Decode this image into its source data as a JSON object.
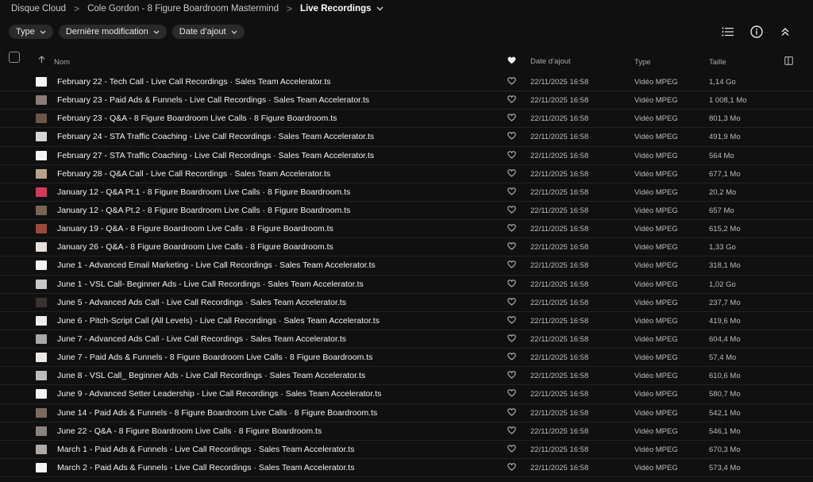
{
  "breadcrumb": {
    "items": [
      "Disque Cloud",
      "Cole Gordon - 8 Figure Boardroom Mastermind"
    ],
    "current": "Live Recordings",
    "separator": ">"
  },
  "filters": [
    {
      "label": "Type"
    },
    {
      "label": "Dernière modification"
    },
    {
      "label": "Date d’ajout"
    }
  ],
  "table": {
    "headers": {
      "name": "Nom",
      "date": "Date d’ajout",
      "type": "Type",
      "size": "Taille"
    },
    "rows": [
      {
        "name": "February 22 - Tech Call - Live Call Recordings · Sales Team Accelerator.ts",
        "date": "22/11/2025 16:58",
        "type": "Vidéo MPEG",
        "size": "1,14 Go",
        "thumb": "#f4f4f4"
      },
      {
        "name": "February 23 - Paid Ads & Funnels - Live Call Recordings · Sales Team Accelerator.ts",
        "date": "22/11/2025 16:58",
        "type": "Vidéo MPEG",
        "size": "1 008,1 Mo",
        "thumb": "#8a7a78"
      },
      {
        "name": "February 23 - Q&A - 8 Figure Boardroom Live Calls · 8 Figure Boardroom.ts",
        "date": "22/11/2025 16:58",
        "type": "Vidéo MPEG",
        "size": "801,3 Mo",
        "thumb": "#6b5648"
      },
      {
        "name": "February 24 - STA Traffic Coaching - Live Call Recordings · Sales Team Accelerator.ts",
        "date": "22/11/2025 16:58",
        "type": "Vidéo MPEG",
        "size": "491,9 Mo",
        "thumb": "#d6d6d6"
      },
      {
        "name": "February 27 - STA Traffic Coaching - Live Call Recordings · Sales Team Accelerator.ts",
        "date": "22/11/2025 16:58",
        "type": "Vidéo MPEG",
        "size": "564 Mo",
        "thumb": "#f4f4f4"
      },
      {
        "name": "February 28 - Q&A Call - Live Call Recordings · Sales Team Accelerator.ts",
        "date": "22/11/2025 16:58",
        "type": "Vidéo MPEG",
        "size": "677,1 Mo",
        "thumb": "#b9a28c"
      },
      {
        "name": "January 12 - Q&A Pt.1 - 8 Figure Boardroom Live Calls · 8 Figure Boardroom.ts",
        "date": "22/11/2025 16:58",
        "type": "Vidéo MPEG",
        "size": "20,2 Mo",
        "thumb": "#d23a5c"
      },
      {
        "name": "January 12 - Q&A Pt.2 - 8 Figure Boardroom Live Calls · 8 Figure Boardroom.ts",
        "date": "22/11/2025 16:58",
        "type": "Vidéo MPEG",
        "size": "657 Mo",
        "thumb": "#7a6552"
      },
      {
        "name": "January 19 - Q&A - 8 Figure Boardroom Live Calls · 8 Figure Boardroom.ts",
        "date": "22/11/2025 16:58",
        "type": "Vidéo MPEG",
        "size": "615,2 Mo",
        "thumb": "#9a4a3a"
      },
      {
        "name": "January 26 - Q&A - 8 Figure Boardroom Live Calls · 8 Figure Boardroom.ts",
        "date": "22/11/2025 16:58",
        "type": "Vidéo MPEG",
        "size": "1,33 Go",
        "thumb": "#e8e0d8"
      },
      {
        "name": "June 1 - Advanced Email Marketing - Live Call Recordings · Sales Team Accelerator.ts",
        "date": "22/11/2025 16:58",
        "type": "Vidéo MPEG",
        "size": "318,1 Mo",
        "thumb": "#f4f4f4"
      },
      {
        "name": "June 1 - VSL Call- Beginner Ads - Live Call Recordings · Sales Team Accelerator.ts",
        "date": "22/11/2025 16:58",
        "type": "Vidéo MPEG",
        "size": "1,02 Go",
        "thumb": "#c8c8c8"
      },
      {
        "name": "June 5 - Advanced Ads Call - Live Call Recordings · Sales Team Accelerator.ts",
        "date": "22/11/2025 16:58",
        "type": "Vidéo MPEG",
        "size": "237,7 Mo",
        "thumb": "#3a3230"
      },
      {
        "name": "June 6 - Pitch-Script Call (All Levels) - Live Call Recordings · Sales Team Accelerator.ts",
        "date": "22/11/2025 16:58",
        "type": "Vidéo MPEG",
        "size": "419,6 Mo",
        "thumb": "#ececec"
      },
      {
        "name": "June 7 - Advanced Ads Call - Live Call Recordings · Sales Team Accelerator.ts",
        "date": "22/11/2025 16:58",
        "type": "Vidéo MPEG",
        "size": "604,4 Mo",
        "thumb": "#a8a8a8"
      },
      {
        "name": "June 7 - Paid Ads & Funnels - 8 Figure Boardroom Live Calls · 8 Figure Boardroom.ts",
        "date": "22/11/2025 16:58",
        "type": "Vidéo MPEG",
        "size": "57,4 Mo",
        "thumb": "#ece8e4"
      },
      {
        "name": "June 8 - VSL Call_ Beginner Ads - Live Call Recordings · Sales Team Accelerator.ts",
        "date": "22/11/2025 16:58",
        "type": "Vidéo MPEG",
        "size": "610,6 Mo",
        "thumb": "#bdbdbd"
      },
      {
        "name": "June 9 - Advanced Setter Leadership - Live Call Recordings · Sales Team Accelerator.ts",
        "date": "22/11/2025 16:58",
        "type": "Vidéo MPEG",
        "size": "580,7 Mo",
        "thumb": "#f4f4f4"
      },
      {
        "name": "June 14 - Paid Ads & Funnels - 8 Figure Boardroom Live Calls · 8 Figure Boardroom.ts",
        "date": "22/11/2025 16:58",
        "type": "Vidéo MPEG",
        "size": "542,1 Mo",
        "thumb": "#7d6a5e"
      },
      {
        "name": "June 22 - Q&A - 8 Figure Boardroom Live Calls · 8 Figure Boardroom.ts",
        "date": "22/11/2025 16:58",
        "type": "Vidéo MPEG",
        "size": "546,1 Mo",
        "thumb": "#8a8480"
      },
      {
        "name": "March 1 - Paid Ads & Funnels - Live Call Recordings · Sales Team Accelerator.ts",
        "date": "22/11/2025 16:58",
        "type": "Vidéo MPEG",
        "size": "670,3 Mo",
        "thumb": "#b0aaa6"
      },
      {
        "name": "March 2 - Paid Ads & Funnels - Live Call Recordings · Sales Team Accelerator.ts",
        "date": "22/11/2025 16:58",
        "type": "Vidéo MPEG",
        "size": "573,4 Mo",
        "thumb": "#f4f4f4"
      }
    ]
  },
  "icons": {
    "list_view": "list-view-icon",
    "info": "info-icon",
    "collapse": "collapse-icon",
    "columns": "columns-icon",
    "sort": "sort-arrow-icon",
    "favorite": "heart-icon"
  }
}
